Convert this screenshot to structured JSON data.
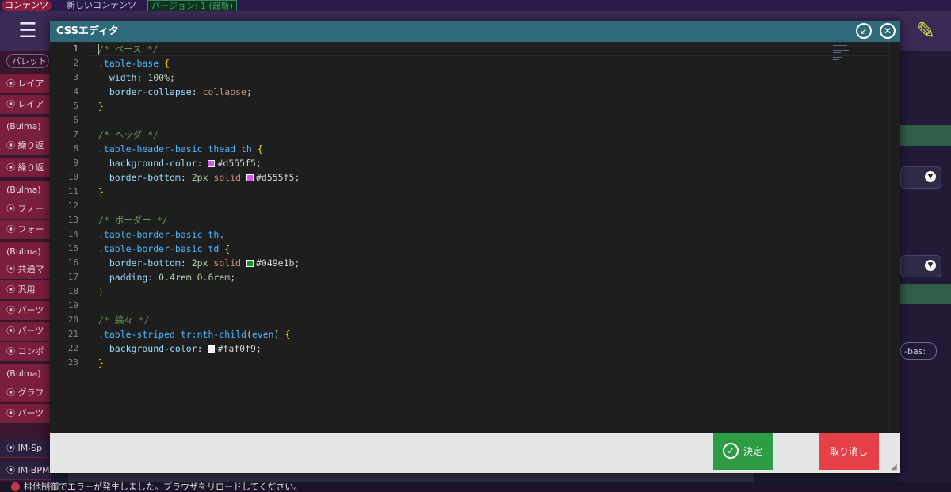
{
  "app": {
    "tab_content": "コンテンツ",
    "tab_new": "新しいコンテンツ",
    "version_badge": "バージョン: 1 (最新)",
    "palette_label": "パレット"
  },
  "left_panel": {
    "items": [
      {
        "label": "⦿ レイア",
        "variant": "red"
      },
      {
        "label": "⦿ レイア",
        "variant": "red"
      },
      {
        "label": "(Bulma)",
        "variant": "red"
      },
      {
        "label": "⦿ 繰り返",
        "variant": "red"
      },
      {
        "label": "⦿ 繰り返",
        "variant": "red"
      },
      {
        "label": "(Bulma)",
        "variant": "red"
      },
      {
        "label": "⦿ フォー",
        "variant": "red"
      },
      {
        "label": "⦿ フォー",
        "variant": "red"
      },
      {
        "label": "(Bulma)",
        "variant": "red"
      },
      {
        "label": "⦿ 共通マ",
        "variant": "red"
      },
      {
        "label": "⦿ 汎用",
        "variant": "red"
      },
      {
        "label": "⦿ パーツ",
        "variant": "red"
      },
      {
        "label": "⦿ パーツ",
        "variant": "red"
      },
      {
        "label": "⦿ コンポ",
        "variant": "red"
      },
      {
        "label": "(Bulma)",
        "variant": "red"
      },
      {
        "label": "⦿ グラフ",
        "variant": "red"
      },
      {
        "label": "⦿ パーツ",
        "variant": "red"
      },
      {
        "label": "⦿ IM-Sp",
        "variant": "dark"
      },
      {
        "label": "⦿ IM-BPM",
        "variant": "dark"
      }
    ]
  },
  "right_panel": {
    "text_field": "-bas:"
  },
  "status": {
    "message": "排他制御でエラーが発生しました。ブラウザをリロードしてください。"
  },
  "dialog": {
    "title": "CSSエディタ",
    "minimize_icon": "↙",
    "close_icon": "✕",
    "ok_label": "決定",
    "cancel_label": "取り消し"
  },
  "editor": {
    "line_numbers": [
      "1",
      "2",
      "3",
      "4",
      "5",
      "6",
      "7",
      "8",
      "9",
      "10",
      "11",
      "12",
      "13",
      "14",
      "15",
      "16",
      "17",
      "18",
      "19",
      "20",
      "21",
      "22",
      "23"
    ],
    "lines": [
      [
        {
          "t": "/* ベース */",
          "c": "cm"
        }
      ],
      [
        {
          "t": ".table-base ",
          "c": "sel2"
        },
        {
          "t": "{",
          "c": "br"
        }
      ],
      [
        {
          "t": "  width",
          "c": "prop"
        },
        {
          "t": ": ",
          "c": "txt"
        },
        {
          "t": "100%",
          "c": "num"
        },
        {
          "t": ";",
          "c": "txt"
        }
      ],
      [
        {
          "t": "  border-collapse",
          "c": "prop"
        },
        {
          "t": ": ",
          "c": "txt"
        },
        {
          "t": "collapse",
          "c": "val"
        },
        {
          "t": ";",
          "c": "txt"
        }
      ],
      [
        {
          "t": "}",
          "c": "br"
        }
      ],
      [],
      [
        {
          "t": "/* ヘッダ */",
          "c": "cm"
        }
      ],
      [
        {
          "t": ".table-header-basic thead th ",
          "c": "sel2"
        },
        {
          "t": "{",
          "c": "br"
        }
      ],
      [
        {
          "t": "  background-color",
          "c": "prop"
        },
        {
          "t": ": ",
          "c": "txt"
        },
        {
          "t": "#d555f5",
          "c": "txt",
          "sw": "#d555f5"
        },
        {
          "t": ";",
          "c": "txt"
        }
      ],
      [
        {
          "t": "  border-bottom",
          "c": "prop"
        },
        {
          "t": ": ",
          "c": "txt"
        },
        {
          "t": "2px ",
          "c": "num"
        },
        {
          "t": "solid ",
          "c": "val"
        },
        {
          "t": "#d555f5",
          "c": "txt",
          "sw": "#d555f5"
        },
        {
          "t": ";",
          "c": "txt"
        }
      ],
      [
        {
          "t": "}",
          "c": "br"
        }
      ],
      [],
      [
        {
          "t": "/* ボーダー */",
          "c": "cm"
        }
      ],
      [
        {
          "t": ".table-border-basic th,",
          "c": "sel2"
        }
      ],
      [
        {
          "t": ".table-border-basic td ",
          "c": "sel2"
        },
        {
          "t": "{",
          "c": "br"
        }
      ],
      [
        {
          "t": "  border-bottom",
          "c": "prop"
        },
        {
          "t": ": ",
          "c": "txt"
        },
        {
          "t": "2px ",
          "c": "num"
        },
        {
          "t": "solid ",
          "c": "val"
        },
        {
          "t": "#049e1b",
          "c": "txt",
          "sw": "#049e1b"
        },
        {
          "t": ";",
          "c": "txt"
        }
      ],
      [
        {
          "t": "  padding",
          "c": "prop"
        },
        {
          "t": ": ",
          "c": "txt"
        },
        {
          "t": "0.4rem 0.6rem",
          "c": "num"
        },
        {
          "t": ";",
          "c": "txt"
        }
      ],
      [
        {
          "t": "}",
          "c": "br"
        }
      ],
      [],
      [
        {
          "t": "/* 縞々 */",
          "c": "cm"
        }
      ],
      [
        {
          "t": ".table-striped tr:nth-child",
          "c": "sel2"
        },
        {
          "t": "(",
          "c": "txt"
        },
        {
          "t": "even",
          "c": "sel2"
        },
        {
          "t": ") ",
          "c": "txt"
        },
        {
          "t": "{",
          "c": "br"
        }
      ],
      [
        {
          "t": "  background-color",
          "c": "prop"
        },
        {
          "t": ": ",
          "c": "txt"
        },
        {
          "t": "#faf0f9",
          "c": "txt",
          "sw": "#faf0f9"
        },
        {
          "t": ";",
          "c": "txt"
        }
      ],
      [
        {
          "t": "}",
          "c": "br"
        }
      ]
    ]
  },
  "colors": {
    "header": "#2f6a7b",
    "ok": "#2e9b45",
    "cancel": "#e54047"
  }
}
